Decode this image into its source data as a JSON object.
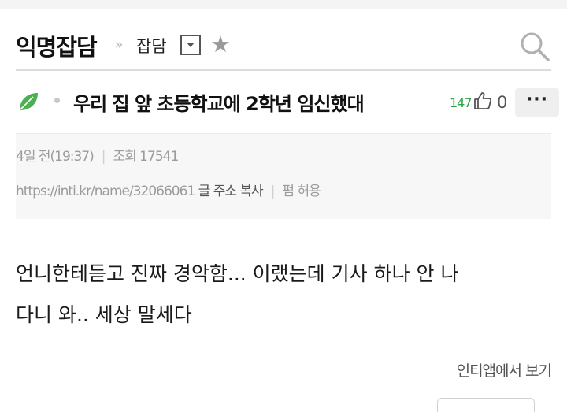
{
  "header": {
    "board_title": "익명잡담",
    "breadcrumb_sep": "»",
    "sub_board": "잡담"
  },
  "post": {
    "title": "우리 집 앞 초등학교에 2학년 임신했대",
    "likes": "147",
    "dislikes": "0",
    "more_label": "···",
    "date": "4일 전(19:37)",
    "views": "조회 17541",
    "url": "https://inti.kr/name/32066061",
    "copy_label": "글 주소 복사",
    "share_label": "펌 허용",
    "body_lines": [
      "언니한테듣고 진짜 경악함... 이랬는데 기사 하나 안 나",
      "다니 와.. 세상 말세다"
    ]
  },
  "footer": {
    "app_link": "인티앱에서 보기"
  },
  "colors": {
    "accent_green": "#2ea24a",
    "leaf_green": "#4caf50"
  }
}
